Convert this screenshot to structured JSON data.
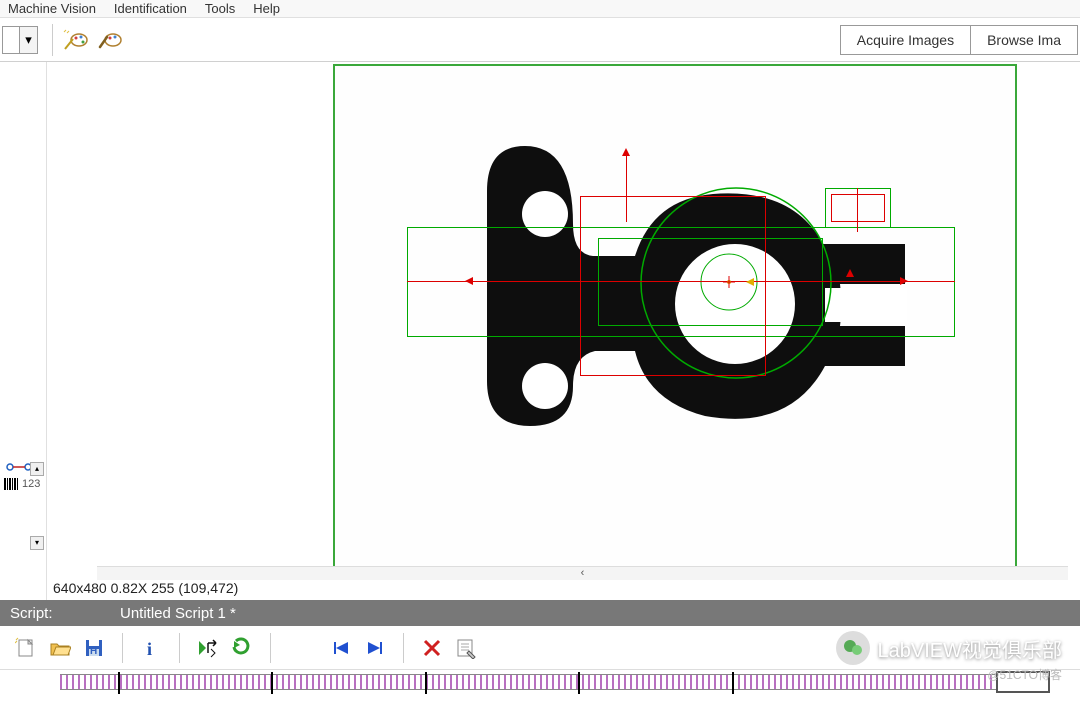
{
  "menu": {
    "items": [
      "Machine Vision",
      "Identification",
      "Tools",
      "Help"
    ]
  },
  "toolbar": {
    "acquire_label": "Acquire Images",
    "browse_label": "Browse Ima"
  },
  "left_panel": {
    "barcode_label": "123"
  },
  "canvas": {
    "status_text": "640x480 0.82X 255   (109,472)"
  },
  "script": {
    "label": "Script:",
    "name": "Untitled Script 1 *"
  },
  "watermark": {
    "text": "LabVIEW视觉俱乐部",
    "sub": "@51CTO博客"
  }
}
